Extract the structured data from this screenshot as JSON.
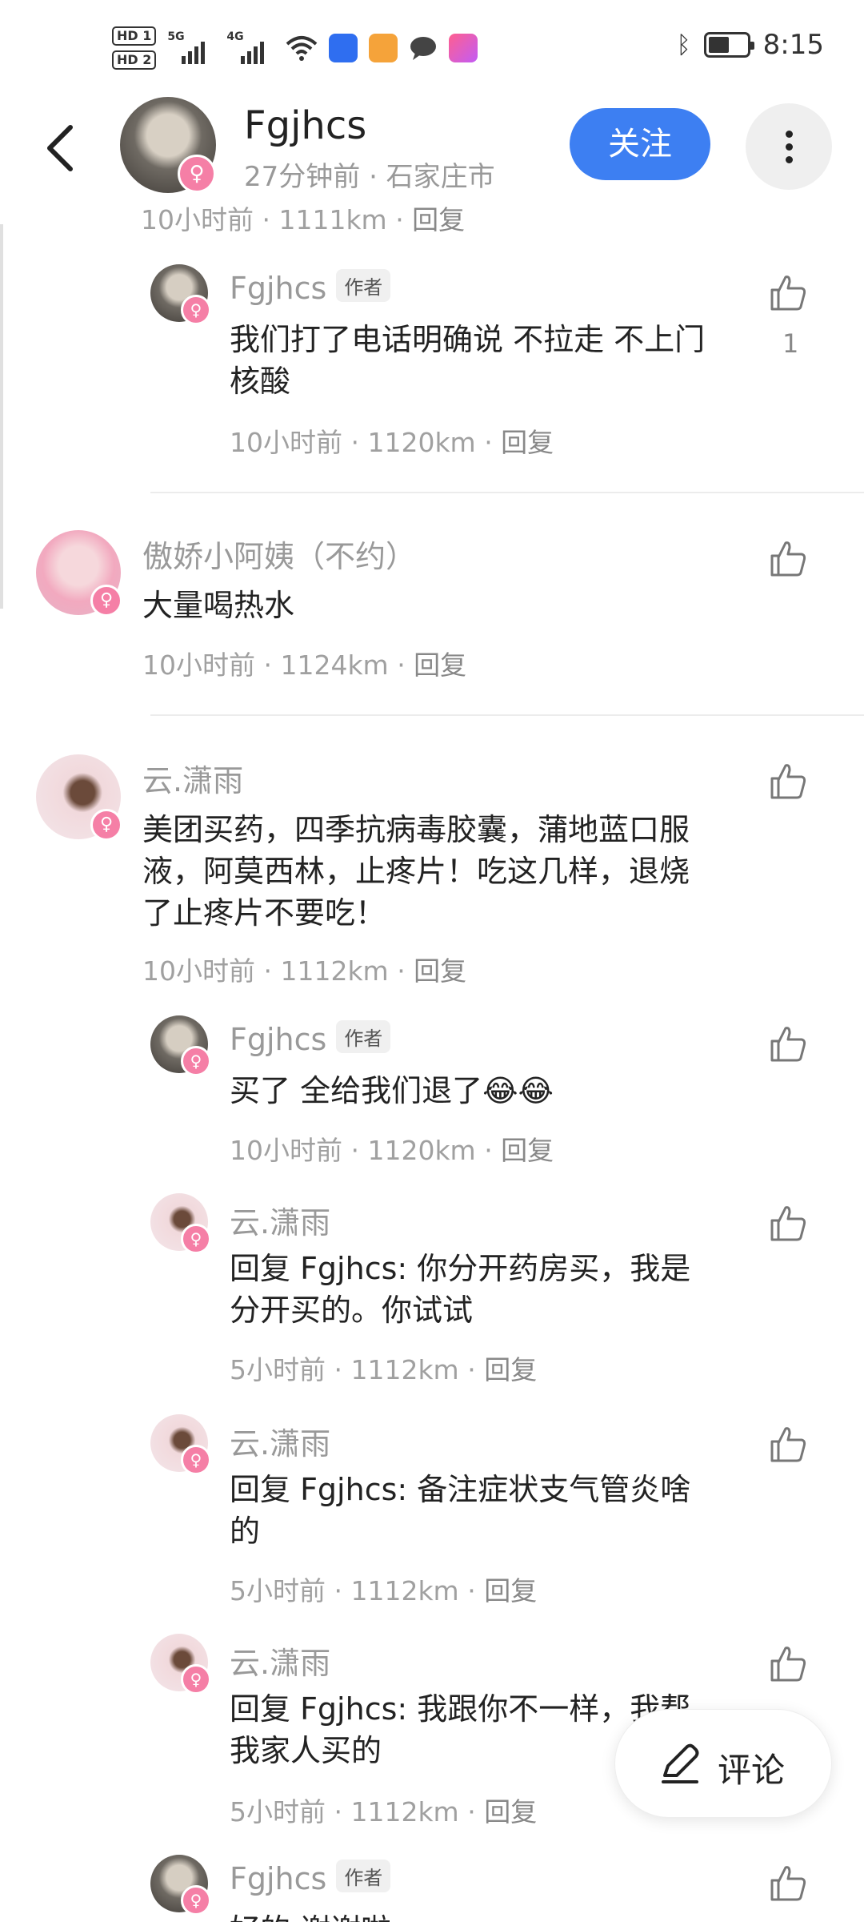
{
  "status_bar": {
    "hd1": "HD 1",
    "hd2": "HD 2",
    "sim1_label": "5G",
    "sim2_label": "4G",
    "time": "8:15",
    "battery_percent": 55
  },
  "header": {
    "user_name": "Fgjhcs",
    "subtitle": "27分钟前 · 石家庄市",
    "follow_label": "关注"
  },
  "comments": {
    "c0": {
      "meta": "10小时前 · 1111km · ",
      "reply": "回复"
    },
    "c1": {
      "name": "Fgjhcs",
      "tag": "作者",
      "text": "我们打了电话明确说 不拉走 不上门核酸",
      "meta": "10小时前 · 1120km · ",
      "reply": "回复",
      "likes": "1"
    },
    "c2": {
      "name": "傲娇小阿姨（不约）",
      "text": "大量喝热水",
      "meta": "10小时前 · 1124km · ",
      "reply": "回复"
    },
    "c3": {
      "name": "云.潇雨",
      "text": "美团买药，四季抗病毒胶囊，蒲地蓝口服液，阿莫西林，止疼片！吃这几样，退烧了止疼片不要吃！",
      "meta": "10小时前 · 1112km · ",
      "reply": "回复"
    },
    "c4": {
      "name": "Fgjhcs",
      "tag": "作者",
      "text": "买了 全给我们退了😂😂",
      "meta": "10小时前 · 1120km · ",
      "reply": "回复"
    },
    "c5": {
      "name": "云.潇雨",
      "text": "回复 Fgjhcs: 你分开药房买，我是分开买的。你试试",
      "meta": "5小时前 · 1112km · ",
      "reply": "回复"
    },
    "c6": {
      "name": "云.潇雨",
      "text": "回复 Fgjhcs: 备注症状支气管炎啥的",
      "meta": "5小时前 · 1112km · ",
      "reply": "回复"
    },
    "c7": {
      "name": "云.潇雨",
      "text": "回复 Fgjhcs: 我跟你不一样，我帮我家人买的",
      "meta": "5小时前 · 1112km · ",
      "reply": "回复"
    },
    "c8": {
      "name": "Fgjhcs",
      "tag": "作者",
      "text": "好的 谢谢啦"
    }
  },
  "fab": {
    "label": "评论"
  },
  "icons": {
    "badge": "female-symbol-icon",
    "like": "thumbs-up-icon",
    "back": "chevron-left-icon",
    "more": "more-vertical-icon",
    "comment": "pen-icon"
  },
  "colors": {
    "accent": "#3d7ff2",
    "female_badge": "#f57fa6",
    "meta_text": "#a0a0a0"
  }
}
